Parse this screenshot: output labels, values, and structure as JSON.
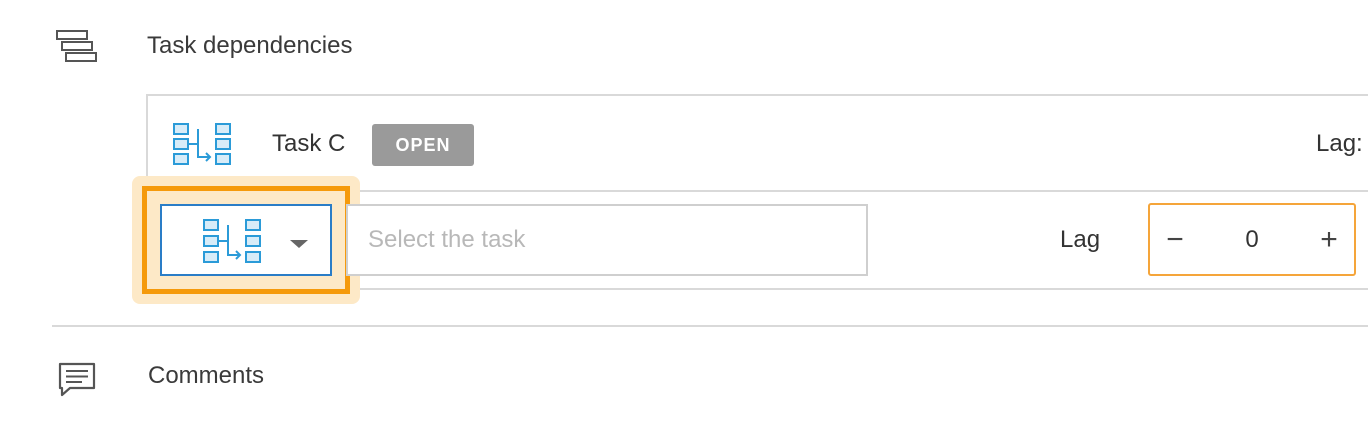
{
  "dependencies_section": {
    "title": "Task dependencies",
    "icon": "gantt-icon",
    "existing": {
      "type_icon": "finish-to-start-icon",
      "task_name": "Task C",
      "status": "OPEN",
      "lag_label": "Lag:"
    },
    "new_dependency": {
      "type_icon": "finish-to-start-icon",
      "type_caret_icon": "caret-down-icon",
      "task_placeholder": "Select the task",
      "task_value": "",
      "lag_label": "Lag",
      "lag_value": "0",
      "minus_label": "−",
      "plus_label": "+"
    }
  },
  "comments_section": {
    "title": "Comments",
    "icon": "comment-icon"
  },
  "colors": {
    "icon_blue": "#2b9bd8",
    "icon_fill": "#d8ecf8",
    "badge_gray": "#9a9a9a",
    "focus_blue": "#2a7dc7",
    "highlight_orange": "#f59a0b",
    "highlight_glow": "#fde9c7",
    "stepper_border": "#f5a53a"
  }
}
